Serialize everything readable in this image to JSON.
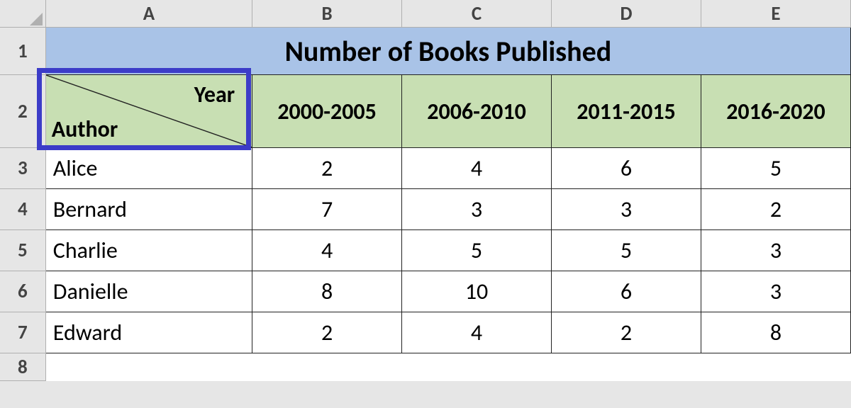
{
  "columns": [
    "A",
    "B",
    "C",
    "D",
    "E"
  ],
  "rows": [
    "1",
    "2",
    "3",
    "4",
    "5",
    "6",
    "7",
    "8"
  ],
  "title": "Number of Books Published",
  "header": {
    "diag_top": "Year",
    "diag_bottom": "Author",
    "periods": [
      "2000-2005",
      "2006-2010",
      "2011-2015",
      "2016-2020"
    ]
  },
  "authors": [
    "Alice",
    "Bernard",
    "Charlie",
    "Danielle",
    "Edward"
  ],
  "values": [
    [
      2,
      4,
      6,
      5
    ],
    [
      7,
      3,
      3,
      2
    ],
    [
      4,
      5,
      5,
      3
    ],
    [
      8,
      10,
      6,
      3
    ],
    [
      2,
      4,
      2,
      8
    ]
  ],
  "chart_data": {
    "type": "table",
    "title": "Number of Books Published",
    "row_label": "Author",
    "col_label": "Year",
    "columns": [
      "2000-2005",
      "2006-2010",
      "2011-2015",
      "2016-2020"
    ],
    "rows": [
      "Alice",
      "Bernard",
      "Charlie",
      "Danielle",
      "Edward"
    ],
    "values": [
      [
        2,
        4,
        6,
        5
      ],
      [
        7,
        3,
        3,
        2
      ],
      [
        4,
        5,
        5,
        3
      ],
      [
        8,
        10,
        6,
        3
      ],
      [
        2,
        4,
        2,
        8
      ]
    ]
  }
}
